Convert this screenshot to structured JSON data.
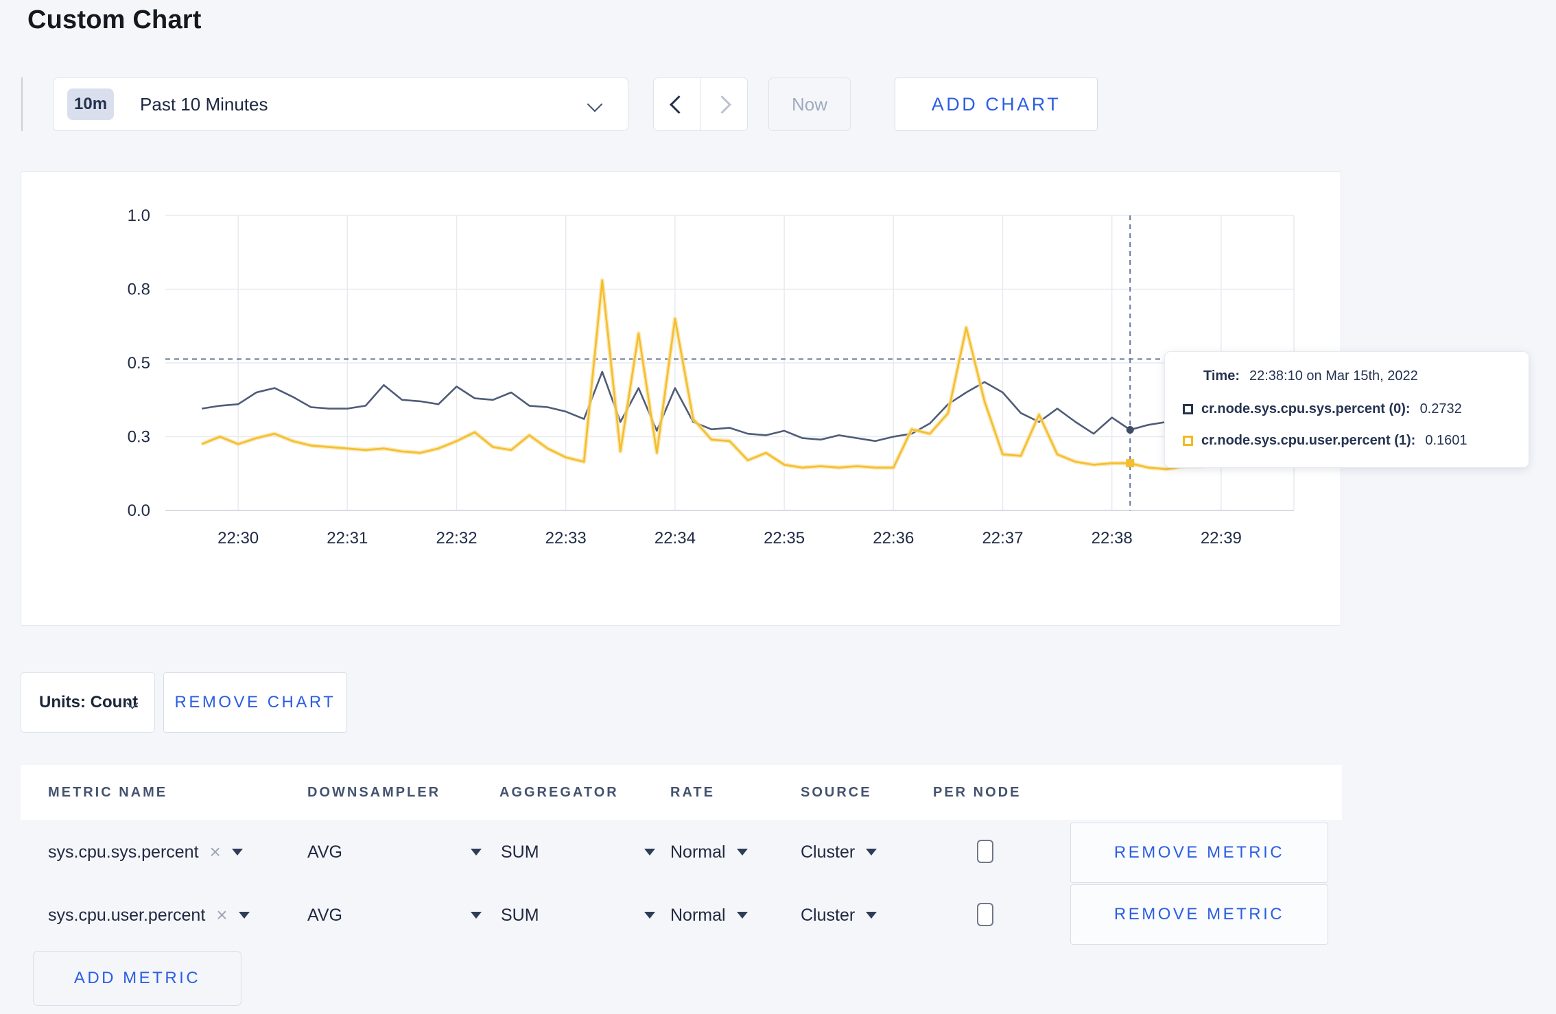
{
  "page": {
    "title": "Custom Chart",
    "background": "#f5f6fa"
  },
  "toolbar": {
    "time_window_badge": "10m",
    "time_window_label": "Past 10 Minutes",
    "now_label": "Now",
    "add_chart_label": "ADD CHART"
  },
  "chart_data": {
    "type": "line",
    "title": "",
    "xlabel": "",
    "ylabel": "",
    "ylim": [
      0,
      1
    ],
    "grid": true,
    "legend_position": "tooltip",
    "x_ticks": [
      "22:30",
      "22:31",
      "22:32",
      "22:33",
      "22:34",
      "22:35",
      "22:36",
      "22:37",
      "22:38",
      "22:39"
    ],
    "y_ticks": {
      "labels": [
        "0.0",
        "0.3",
        "0.5",
        "0.8",
        "1.0"
      ],
      "values": [
        0,
        0.25,
        0.5,
        0.75,
        1.0
      ]
    },
    "start_time": "22:29:40",
    "interval_seconds": 10,
    "series": [
      {
        "name": "cr.node.sys.cpu.sys.percent",
        "color": "#4e5c77",
        "halo": false,
        "marker": "circle",
        "values": [
          0.345,
          0.355,
          0.36,
          0.4,
          0.415,
          0.385,
          0.35,
          0.345,
          0.345,
          0.355,
          0.425,
          0.375,
          0.37,
          0.36,
          0.42,
          0.38,
          0.375,
          0.4,
          0.355,
          0.35,
          0.335,
          0.31,
          0.47,
          0.3,
          0.415,
          0.27,
          0.415,
          0.3,
          0.275,
          0.28,
          0.26,
          0.255,
          0.27,
          0.245,
          0.24,
          0.255,
          0.245,
          0.235,
          0.25,
          0.26,
          0.295,
          0.36,
          0.4,
          0.435,
          0.4,
          0.33,
          0.3,
          0.345,
          0.3,
          0.26,
          0.315,
          0.2732,
          0.29,
          0.3,
          0.31,
          0.295,
          0.3,
          0.31,
          0.3
        ]
      },
      {
        "name": "cr.node.sys.cpu.user.percent",
        "color": "#f3bf2e",
        "halo": true,
        "halo_color": "#fbdf9a",
        "marker": "square",
        "values": [
          0.225,
          0.25,
          0.225,
          0.245,
          0.26,
          0.235,
          0.22,
          0.215,
          0.21,
          0.205,
          0.21,
          0.2,
          0.195,
          0.21,
          0.235,
          0.265,
          0.215,
          0.205,
          0.255,
          0.21,
          0.18,
          0.165,
          0.78,
          0.2,
          0.6,
          0.195,
          0.65,
          0.31,
          0.24,
          0.235,
          0.17,
          0.195,
          0.155,
          0.145,
          0.15,
          0.145,
          0.15,
          0.145,
          0.145,
          0.275,
          0.26,
          0.33,
          0.62,
          0.37,
          0.19,
          0.185,
          0.325,
          0.19,
          0.165,
          0.155,
          0.16,
          0.1601,
          0.145,
          0.14,
          0.15,
          0.15,
          0.27,
          0.215,
          0.26
        ]
      }
    ],
    "crosshair": {
      "index": 51,
      "time_label": "22:38:10",
      "hline_value": 0.513
    }
  },
  "tooltip": {
    "time_label": "Time:",
    "time_value": "22:38:10 on Mar 15th, 2022",
    "rows": [
      {
        "name": "cr.node.sys.cpu.sys.percent (0):",
        "value": "0.2732",
        "color": "#26334d"
      },
      {
        "name": "cr.node.sys.cpu.user.percent (1):",
        "value": "0.1601",
        "color": "#f1ba1f"
      }
    ]
  },
  "chart_controls": {
    "units_label": "Units: Count",
    "remove_chart_label": "REMOVE CHART"
  },
  "metrics_table": {
    "headers": [
      "METRIC NAME",
      "DOWNSAMPLER",
      "AGGREGATOR",
      "RATE",
      "SOURCE",
      "PER NODE"
    ],
    "rows": [
      {
        "metric_name": "sys.cpu.sys.percent",
        "downsampler": "AVG",
        "aggregator": "SUM",
        "rate": "Normal",
        "source": "Cluster",
        "per_node_checked": false,
        "remove_label": "REMOVE METRIC"
      },
      {
        "metric_name": "sys.cpu.user.percent",
        "downsampler": "AVG",
        "aggregator": "SUM",
        "rate": "Normal",
        "source": "Cluster",
        "per_node_checked": false,
        "remove_label": "REMOVE METRIC"
      }
    ],
    "add_metric_label": "ADD METRIC"
  },
  "icons": {
    "close_x": "×"
  },
  "colors": {
    "accent_blue": "#2c5ee2",
    "sys_line": "#4e5c77",
    "user_line": "#f3bf2e",
    "crosshair": "#66779a",
    "grid": "#e8eaf0"
  }
}
